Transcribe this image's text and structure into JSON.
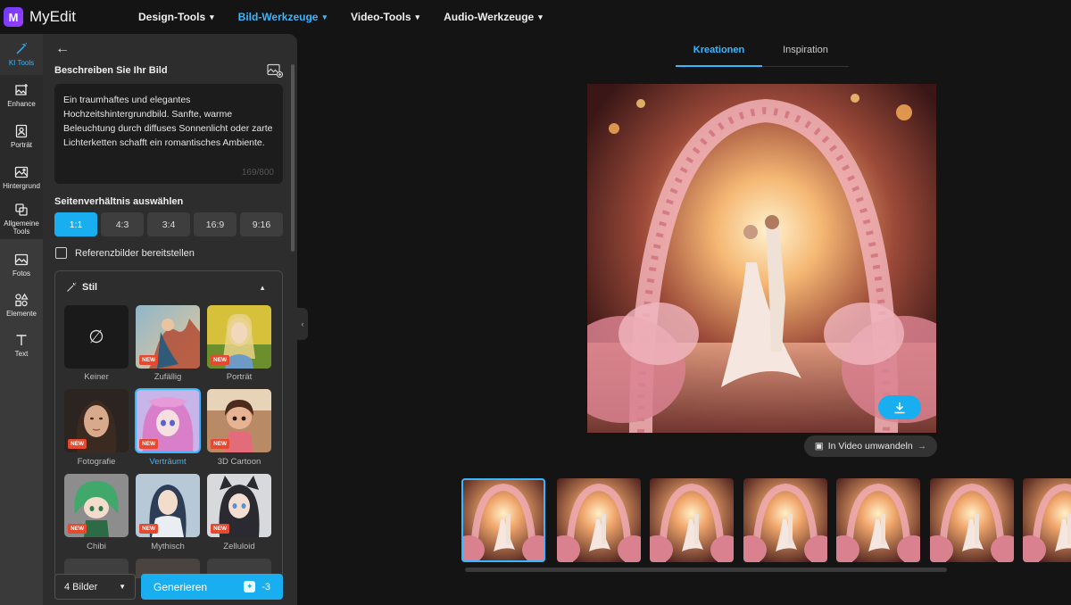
{
  "app": {
    "name": "MyEdit",
    "logo_letter": "M"
  },
  "topnav": {
    "items": [
      {
        "label": "Design-Tools",
        "active": false
      },
      {
        "label": "Bild-Werkzeuge",
        "active": true
      },
      {
        "label": "Video-Tools",
        "active": false
      },
      {
        "label": "Audio-Werkzeuge",
        "active": false
      }
    ]
  },
  "rail": {
    "items": [
      {
        "label": "KI Tools",
        "icon": "magic-wand-icon",
        "active": true
      },
      {
        "label": "Enhance",
        "icon": "enhance-icon"
      },
      {
        "label": "Porträt",
        "icon": "portrait-icon"
      },
      {
        "label": "Hintergrund",
        "icon": "background-icon"
      },
      {
        "label": "Allgemeine Tools",
        "icon": "tools-icon"
      },
      {
        "label": "Fotos",
        "icon": "photos-icon"
      },
      {
        "label": "Elemente",
        "icon": "elements-icon"
      },
      {
        "label": "Text",
        "icon": "text-icon"
      }
    ]
  },
  "panel": {
    "describe_title": "Beschreiben Sie Ihr Bild",
    "prompt": "Ein traumhaftes und elegantes Hochzeitshintergrundbild. Sanfte, warme Beleuchtung durch diffuses Sonnenlicht oder zarte Lichterketten schafft ein romantisches Ambiente.",
    "prompt_count": "169/800",
    "ratio_title": "Seitenverhältnis auswählen",
    "ratios": [
      "1:1",
      "4:3",
      "3:4",
      "16:9",
      "9:16"
    ],
    "ratio_selected": "1:1",
    "reference_label": "Referenzbilder bereitstellen",
    "style_title": "Stil",
    "styles": [
      {
        "label": "Keiner",
        "new": false,
        "selected": false
      },
      {
        "label": "Zufällig",
        "new": true,
        "selected": false
      },
      {
        "label": "Porträt",
        "new": true,
        "selected": false
      },
      {
        "label": "Fotografie",
        "new": true,
        "selected": false
      },
      {
        "label": "Verträumt",
        "new": true,
        "selected": true
      },
      {
        "label": "3D Cartoon",
        "new": true,
        "selected": false
      },
      {
        "label": "Chibi",
        "new": true,
        "selected": false
      },
      {
        "label": "Mythisch",
        "new": true,
        "selected": false
      },
      {
        "label": "Zelluloid",
        "new": true,
        "selected": false
      }
    ],
    "new_badge": "NEW",
    "none_symbol": "∅",
    "count_select": "4 Bilder",
    "generate_label": "Generieren",
    "generate_cost": "-3"
  },
  "main": {
    "tabs": [
      {
        "label": "Kreationen",
        "active": true
      },
      {
        "label": "Inspiration",
        "active": false
      }
    ],
    "video_button": "In Video umwandeln",
    "thumbnail_count": 7,
    "selected_thumbnail": 0
  },
  "colors": {
    "accent": "#18aef0",
    "badge": "#e6492d",
    "background": "#141414",
    "panel": "#2d2d2d"
  }
}
